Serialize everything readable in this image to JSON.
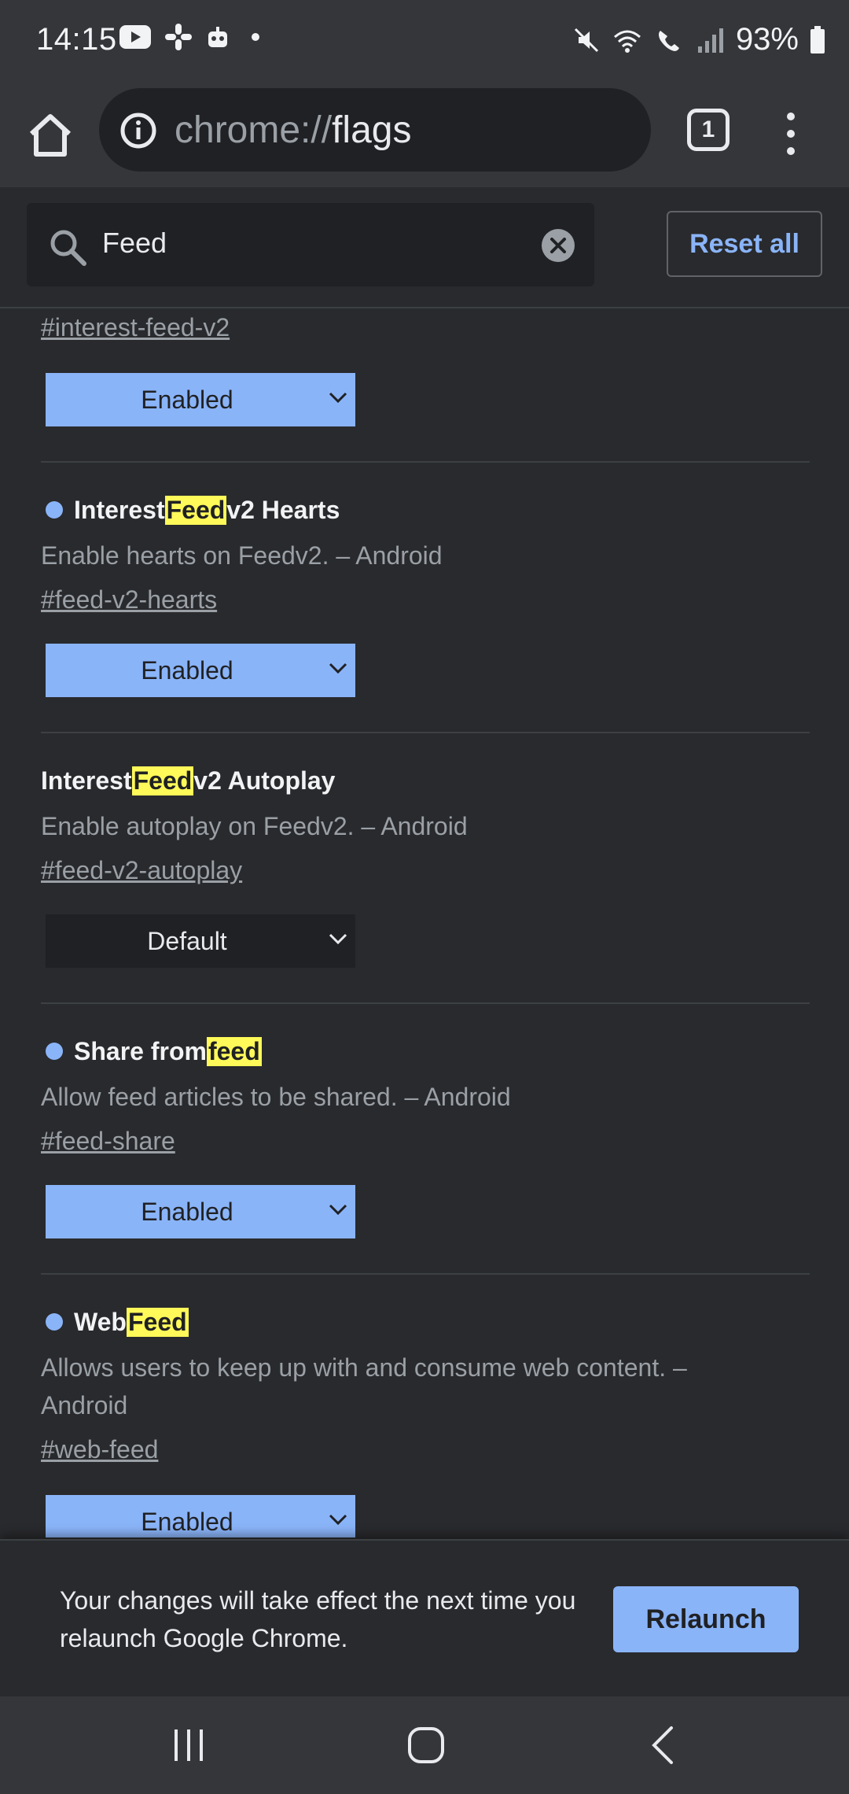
{
  "status": {
    "time": "14:15",
    "battery": "93%",
    "left_icons": [
      "youtube-icon",
      "slack-icon",
      "bot-icon",
      "dot-icon"
    ],
    "right_icons": [
      "mute-icon",
      "wifi-icon",
      "call-icon",
      "signal-icon",
      "battery-icon"
    ]
  },
  "toolbar": {
    "url_scheme": "chrome://",
    "url_host": "flags",
    "tab_count": "1"
  },
  "search": {
    "value": "Feed",
    "reset_label": "Reset all"
  },
  "experiments": [
    {
      "title_parts": [],
      "description": "",
      "link": "#interest-feed-v2",
      "select": "Enabled"
    },
    {
      "title_before": "Interest ",
      "title_highlight": "Feed",
      "title_after": " v2 Hearts",
      "description": "Enable hearts on Feedv2. – Android",
      "link": "#feed-v2-hearts",
      "select": "Enabled"
    },
    {
      "title_before": "Interest ",
      "title_highlight": "Feed",
      "title_after": " v2 Autoplay",
      "description": "Enable autoplay on Feedv2. – Android",
      "link": "#feed-v2-autoplay",
      "select": "Default"
    },
    {
      "title_before": "Share from ",
      "title_highlight": "feed",
      "title_after": "",
      "description": "Allow feed articles to be shared. – Android",
      "link": "#feed-share",
      "select": "Enabled"
    },
    {
      "title_before": "Web ",
      "title_highlight": "Feed",
      "title_after": "",
      "description": "Allows users to keep up with and consume web content. – Android",
      "link": "#web-feed",
      "select": "Enabled"
    }
  ],
  "bottom": {
    "message": "Your changes will take effect the next time you relaunch Google Chrome.",
    "relaunch_label": "Relaunch"
  },
  "colors": {
    "accent": "#8ab4f8",
    "highlight": "#fff959",
    "background": "#292a2d"
  }
}
